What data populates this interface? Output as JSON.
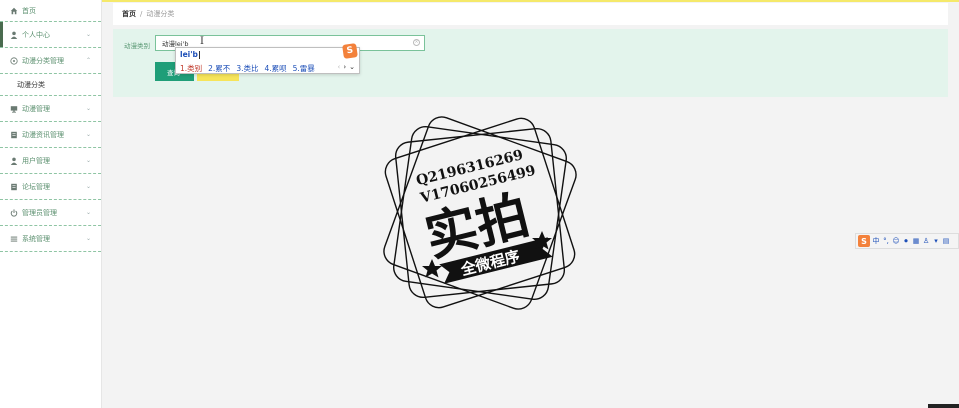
{
  "sidebar": {
    "items": [
      {
        "label": "首页",
        "icon": "home-icon"
      },
      {
        "label": "个人中心",
        "icon": "user-icon"
      },
      {
        "label": "动漫分类管理",
        "icon": "tag-icon"
      },
      {
        "label": "动漫管理",
        "icon": "monitor-icon"
      },
      {
        "label": "动漫资讯管理",
        "icon": "news-icon"
      },
      {
        "label": "用户管理",
        "icon": "user-icon"
      },
      {
        "label": "论坛管理",
        "icon": "forum-icon"
      },
      {
        "label": "管理员管理",
        "icon": "power-icon"
      },
      {
        "label": "系统管理",
        "icon": "list-icon"
      }
    ],
    "sub_item": "动漫分类"
  },
  "breadcrumb": {
    "home": "首页",
    "separator": "/",
    "current": "动漫分类"
  },
  "search": {
    "label": "动漫类别",
    "value": "动漫lei'b",
    "search_button": "查询"
  },
  "ime": {
    "pinyin": "lei'b",
    "candidates": [
      "1.类别",
      "2.累不",
      "3.类比",
      "4.累呗",
      "5.雷暴"
    ],
    "logo": "S"
  },
  "stamp": {
    "line1": "Q2196316269",
    "line2": "V17060256499",
    "big_text": "实拍",
    "banner_text": "全微程序"
  },
  "ime_toolbar": {
    "logo": "S",
    "lang": "中"
  },
  "colors": {
    "accent": "#1f9e78",
    "panel": "#e3f4ec",
    "topbar": "#f5e96a",
    "add_button": "#f6e45a"
  }
}
